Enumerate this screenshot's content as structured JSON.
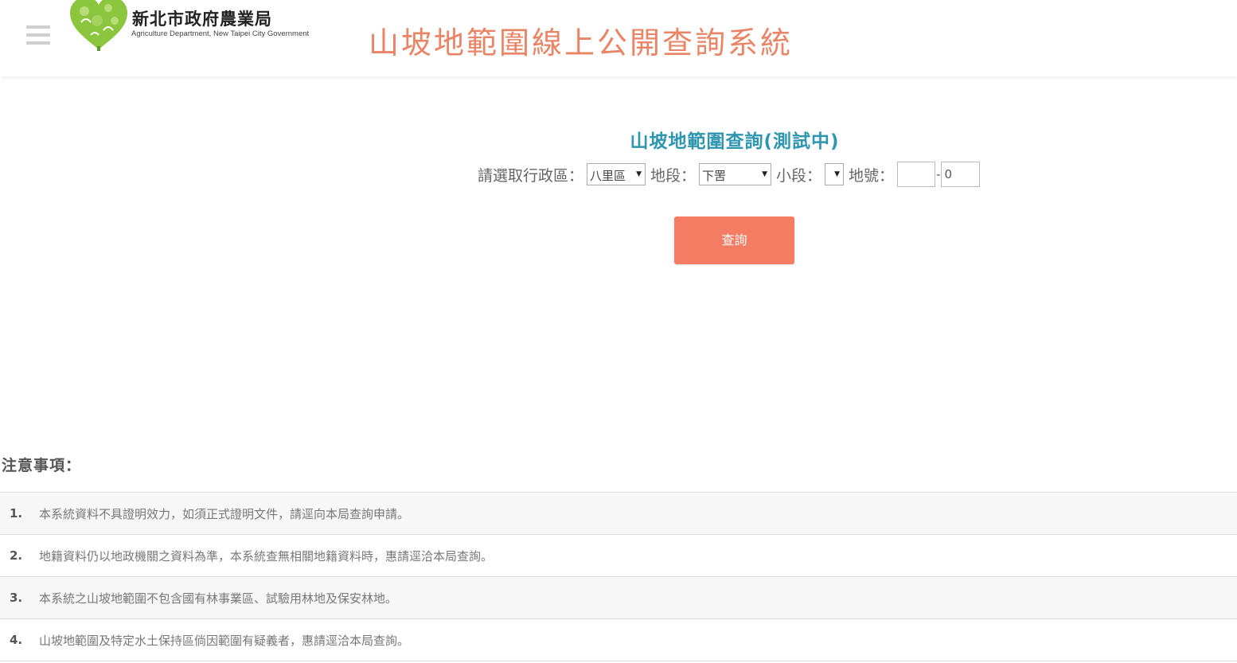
{
  "header": {
    "org_name": "新北市政府農業局",
    "org_name_en": "Agriculture Department, New Taipei City Government",
    "site_title": "山坡地範圍線上公開查詢系統"
  },
  "query": {
    "title": "山坡地範圍查詢(測試中)",
    "district_label": "請選取行政區：",
    "district_value": "八里區",
    "section_label": "地段：",
    "section_value": "下罟",
    "subsection_label": "小段：",
    "subsection_value": "",
    "landno_label": "地號：",
    "landno_main_value": "",
    "landno_dash": "-",
    "landno_sub_value": "0",
    "submit_label": "查詢"
  },
  "notes": {
    "title": "注意事項：",
    "items": [
      {
        "num": "1.",
        "text": "本系統資料不具證明效力，如須正式證明文件，請逕向本局查詢申請。"
      },
      {
        "num": "2.",
        "text": "地籍資料仍以地政機關之資料為準，本系統查無相關地籍資料時，惠請逕洽本局查詢。"
      },
      {
        "num": "3.",
        "text": "本系統之山坡地範圍不包含國有林事業區、試驗用林地及保安林地。"
      },
      {
        "num": "4.",
        "text": "山坡地範圍及特定水土保持區倘因範圍有疑義者，惠請逕洽本局查詢。"
      }
    ]
  },
  "colors": {
    "title_accent": "#ea8466",
    "query_title": "#2f96b0",
    "button": "#f47c63"
  }
}
